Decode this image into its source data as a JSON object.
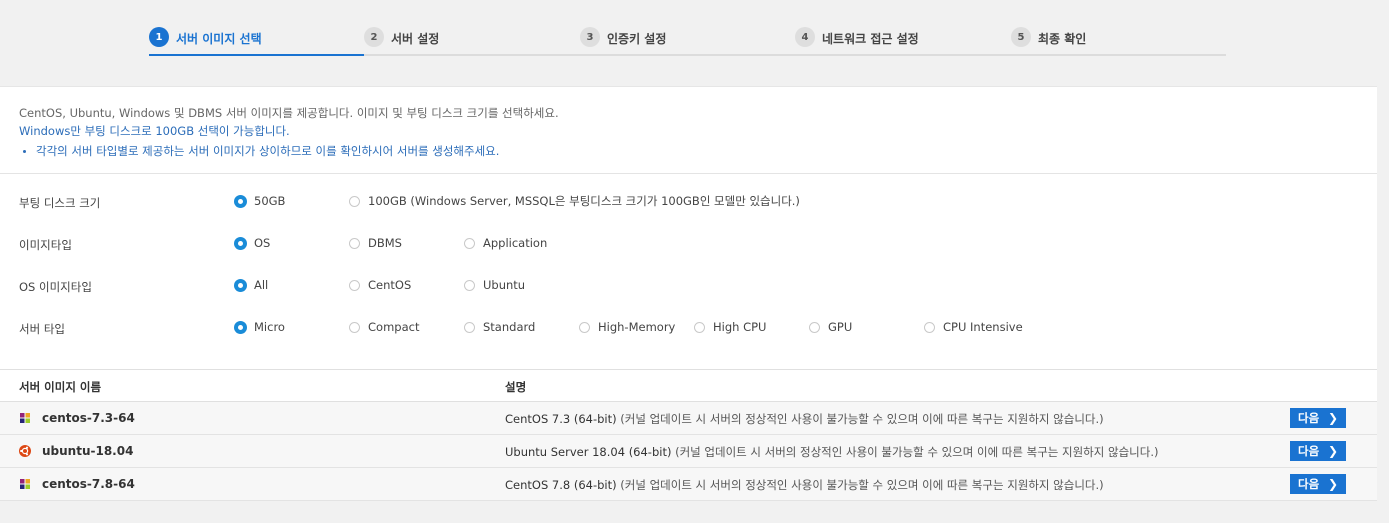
{
  "steps": [
    {
      "num": "1",
      "label": "서버 이미지 선택"
    },
    {
      "num": "2",
      "label": "서버 설정"
    },
    {
      "num": "3",
      "label": "인증키 설정"
    },
    {
      "num": "4",
      "label": "네트워크 접근 설정"
    },
    {
      "num": "5",
      "label": "최종 확인"
    }
  ],
  "intro": {
    "line1": "CentOS, Ubuntu, Windows 및 DBMS 서버 이미지를 제공합니다. 이미지 및 부팅 디스크 크기를 선택하세요.",
    "line2": "Windows만 부팅 디스크로 100GB 선택이 가능합니다.",
    "bullet": "각각의 서버 타입별로 제공하는 서버 이미지가 상이하므로 이를 확인하시어 서버를 생성해주세요."
  },
  "options": {
    "boot_disk": {
      "label": "부팅 디스크 크기",
      "choices": [
        "50GB",
        "100GB (Windows Server, MSSQL은 부팅디스크 크기가 100GB인 모델만 있습니다.)"
      ],
      "selected": "50GB"
    },
    "image_type": {
      "label": "이미지타입",
      "choices": [
        "OS",
        "DBMS",
        "Application"
      ],
      "selected": "OS"
    },
    "os_image_type": {
      "label": "OS 이미지타입",
      "choices": [
        "All",
        "CentOS",
        "Ubuntu"
      ],
      "selected": "All"
    },
    "server_type": {
      "label": "서버 타입",
      "choices": [
        "Micro",
        "Compact",
        "Standard",
        "High-Memory",
        "High CPU",
        "GPU",
        "CPU Intensive"
      ],
      "selected": "Micro"
    }
  },
  "table": {
    "headers": {
      "name": "서버 이미지 이름",
      "desc": "설명"
    },
    "rows": [
      {
        "icon": "centos-icon",
        "name": "centos-7.3-64",
        "desc": "CentOS 7.3 (64-bit)",
        "note": "(커널 업데이트 시 서버의 정상적인 사용이 불가능할 수 있으며 이에 따른 복구는 지원하지 않습니다.)",
        "button": "다음"
      },
      {
        "icon": "ubuntu-icon",
        "name": "ubuntu-18.04",
        "desc": "Ubuntu Server 18.04 (64-bit)",
        "note": "(커널 업데이트 시 서버의 정상적인 사용이 불가능할 수 있으며 이에 따른 복구는 지원하지 않습니다.)",
        "button": "다음"
      },
      {
        "icon": "centos-icon",
        "name": "centos-7.8-64",
        "desc": "CentOS 7.8 (64-bit)",
        "note": "(커널 업데이트 시 서버의 정상적인 사용이 불가능할 수 있으며 이에 따른 복구는 지원하지 않습니다.)",
        "button": "다음"
      }
    ]
  },
  "colors": {
    "accent": "#1a73d1",
    "radio_selected": "#1a8cd8",
    "ubuntu": "#dd4814"
  }
}
